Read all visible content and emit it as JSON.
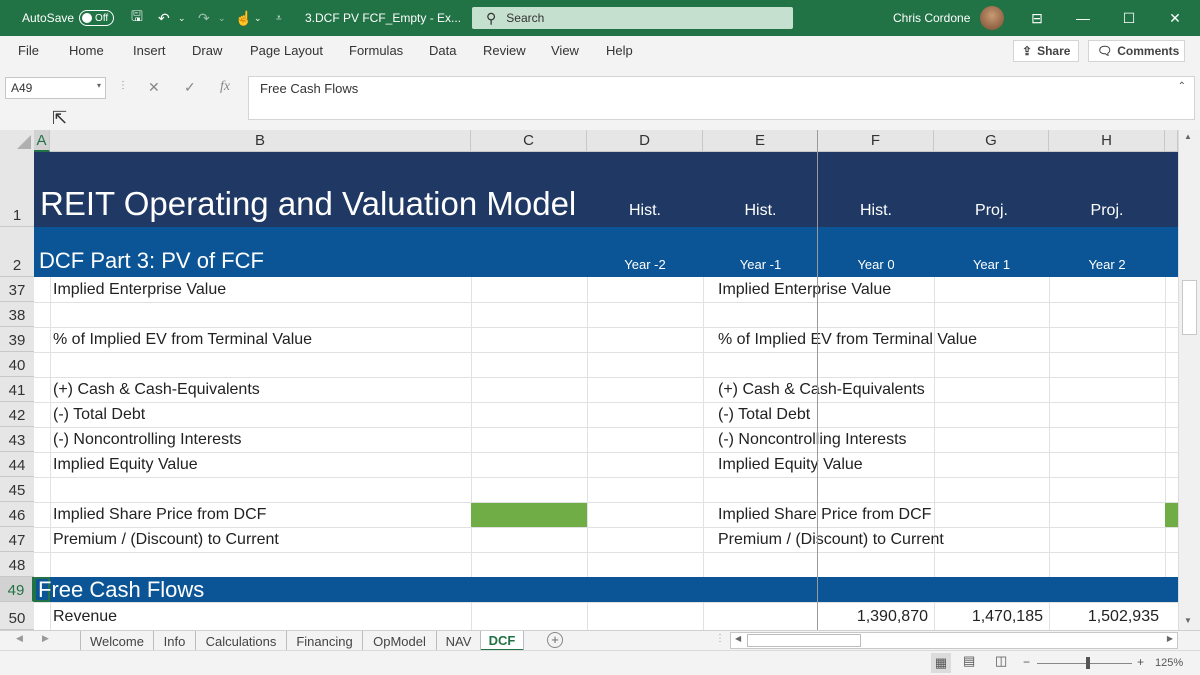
{
  "titlebar": {
    "autosave_label": "AutoSave",
    "autosave_state": "Off",
    "filename": "3.DCF PV FCF_Empty  -  Ex...",
    "search_placeholder": "Search",
    "user": "Chris Cordone"
  },
  "menu": [
    "File",
    "Home",
    "Insert",
    "Draw",
    "Page Layout",
    "Formulas",
    "Data",
    "Review",
    "View",
    "Help"
  ],
  "ribbon_buttons": {
    "share": "Share",
    "comments": "Comments"
  },
  "namebox": "A49",
  "formula": "Free Cash Flows",
  "columns": [
    "A",
    "B",
    "C",
    "D",
    "E",
    "F",
    "G",
    "H"
  ],
  "rows": {
    "r1": {
      "num": "1",
      "title": "REIT Operating and Valuation Model",
      "d": "Hist.",
      "e": "Hist.",
      "f": "Hist.",
      "g": "Proj.",
      "h": "Proj."
    },
    "r2": {
      "num": "2",
      "title": "DCF Part 3: PV of FCF",
      "d": "Year -2",
      "e": "Year -1",
      "f": "Year 0",
      "g": "Year 1",
      "h": "Year 2"
    },
    "r37": {
      "num": "37",
      "b": "Implied Enterprise Value",
      "e": "Implied Enterprise Value"
    },
    "r38": {
      "num": "38"
    },
    "r39": {
      "num": "39",
      "b": "% of Implied EV from Terminal Value",
      "e": "% of Implied EV from Terminal Value"
    },
    "r40": {
      "num": "40"
    },
    "r41": {
      "num": "41",
      "b": "(+) Cash & Cash-Equivalents",
      "e": "(+) Cash & Cash-Equivalents"
    },
    "r42": {
      "num": "42",
      "b": "(-) Total Debt",
      "e": "(-) Total Debt"
    },
    "r43": {
      "num": "43",
      "b": "(-) Noncontrolling Interests",
      "e": "(-) Noncontrolling Interests"
    },
    "r44": {
      "num": "44",
      "b": "Implied Equity Value",
      "e": "Implied Equity Value"
    },
    "r45": {
      "num": "45"
    },
    "r46": {
      "num": "46",
      "b": "Implied Share Price from DCF",
      "e": "Implied Share Price from DCF"
    },
    "r47": {
      "num": "47",
      "b": "Premium / (Discount) to Current",
      "e": "Premium / (Discount) to Current"
    },
    "r48": {
      "num": "48"
    },
    "r49": {
      "num": "49",
      "a": "Free Cash Flows"
    },
    "r50": {
      "num": "50",
      "b": "Revenue",
      "f": "1,390,870",
      "g": "1,470,185",
      "h": "1,502,935"
    }
  },
  "sheet_tabs": [
    "Welcome",
    "Info",
    "Calculations",
    "Financing",
    "OpModel",
    "NAV",
    "DCF"
  ],
  "status": {
    "zoom": "125%"
  },
  "colors": {
    "excel_green": "#217346",
    "title_navy": "#1f3864",
    "header_blue": "#0b5496",
    "green_fill": "#70ad47"
  }
}
